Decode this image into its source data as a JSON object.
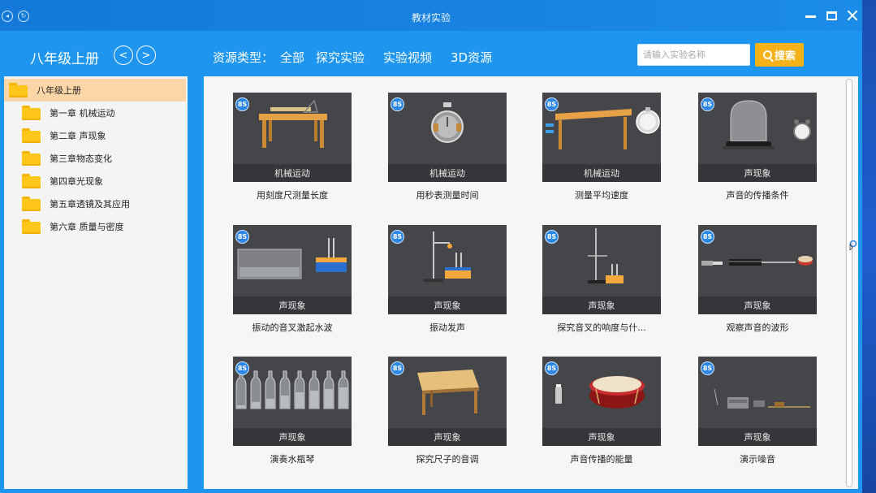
{
  "window": {
    "title": "教材实验"
  },
  "colors": {
    "title_bar": "#1479d9",
    "nav_bar": "#1e95ee",
    "accent_orange": "#f7b21a",
    "selected_row": "#fcd6a6",
    "card_bg": "#444649"
  },
  "nav": {
    "grade_title": "八年级上册",
    "resource_type_label": "资源类型：",
    "resource_types": [
      "全部",
      "探究实验",
      "实验视频",
      "3D资源"
    ],
    "search": {
      "placeholder": "请输入实验名称",
      "button_label": "搜索"
    }
  },
  "sidebar": {
    "root_label": "八年级上册",
    "chapters": [
      {
        "label": "第一章 机械运动"
      },
      {
        "label": "第二章 声现象"
      },
      {
        "label": "第三章物态变化"
      },
      {
        "label": "第四章光现象"
      },
      {
        "label": "第五章透镜及其应用"
      },
      {
        "label": "第六章 质量与密度"
      }
    ]
  },
  "experiments": [
    {
      "category": "机械运动",
      "title": "用刻度尺测量长度",
      "badge": "8S",
      "icon": "ruler-table"
    },
    {
      "category": "机械运动",
      "title": "用秒表测量时间",
      "badge": "8S",
      "icon": "stopwatch"
    },
    {
      "category": "机械运动",
      "title": "测量平均速度",
      "badge": "8S",
      "icon": "incline-stopwatch"
    },
    {
      "category": "声现象",
      "title": "声音的传播条件",
      "badge": "8S",
      "icon": "bell-jar"
    },
    {
      "category": "声现象",
      "title": "振动的音叉激起水波",
      "badge": "8S",
      "icon": "water-tank-fork"
    },
    {
      "category": "声现象",
      "title": "振动发声",
      "badge": "8S",
      "icon": "fork-stand"
    },
    {
      "category": "声现象",
      "title": "探究音叉的响度与什...",
      "badge": "8S",
      "icon": "pendulum-fork"
    },
    {
      "category": "声现象",
      "title": "观察声音的波形",
      "badge": "8S",
      "icon": "oscilloscope"
    },
    {
      "category": "声现象",
      "title": "演奏水瓶琴",
      "badge": "8S",
      "icon": "bottles"
    },
    {
      "category": "声现象",
      "title": "探究尺子的音调",
      "badge": "8S",
      "icon": "ruler-on-table"
    },
    {
      "category": "声现象",
      "title": "声音传播的能量",
      "badge": "8S",
      "icon": "drum-candle"
    },
    {
      "category": "声现象",
      "title": "演示噪音",
      "badge": "8S",
      "icon": "noise-device"
    }
  ]
}
